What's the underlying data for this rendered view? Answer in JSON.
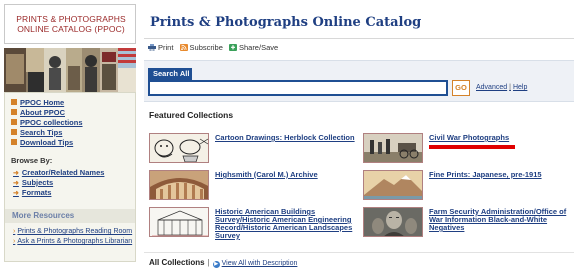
{
  "logo": {
    "line1": "PRINTS & PHOTOGRAPHS",
    "line2": "ONLINE CATALOG (PPOC)"
  },
  "sidebar": {
    "nav_items": [
      {
        "label": "PPOC Home"
      },
      {
        "label": "About PPOC"
      },
      {
        "label": "PPOC collections"
      },
      {
        "label": "Search Tips"
      },
      {
        "label": "Download Tips"
      }
    ],
    "browse_title": "Browse By:",
    "browse_items": [
      {
        "label": "Creator/Related Names"
      },
      {
        "label": "Subjects"
      },
      {
        "label": "Formats"
      }
    ],
    "more_title": "More Resources",
    "more_items": [
      {
        "label": "Prints & Photographs Reading Room"
      },
      {
        "label": "Ask a Prints & Photographs Librarian"
      }
    ]
  },
  "header": {
    "title": "Prints & Photographs Online Catalog"
  },
  "tools": {
    "print": "Print",
    "subscribe": "Subscribe",
    "share": "Share/Save"
  },
  "search": {
    "tab_label": "Search All",
    "input_value": "",
    "go_label": "GO",
    "advanced": "Advanced",
    "separator": "|",
    "help": "Help"
  },
  "featured": {
    "title": "Featured Collections",
    "collections": [
      {
        "label": "Cartoon Drawings: Herblock Collection"
      },
      {
        "label": "Civil War Photographs"
      },
      {
        "label": "Highsmith (Carol M.) Archive"
      },
      {
        "label": "Fine Prints: Japanese, pre-1915"
      },
      {
        "label": "Historic American Buildings Survey/Historic American Engineering Record/Historic American Landscapes Survey"
      },
      {
        "label": "Farm Security Administration/Office of War Information Black-and-White Negatives"
      }
    ]
  },
  "footer": {
    "all_label": "All Collections",
    "separator": "|",
    "view_all": "View All with Description"
  },
  "colors": {
    "accent": "#1f4f93",
    "orange": "#d4822a",
    "highlight_bar": "#e00000",
    "logo_red": "#9b2a2a"
  }
}
